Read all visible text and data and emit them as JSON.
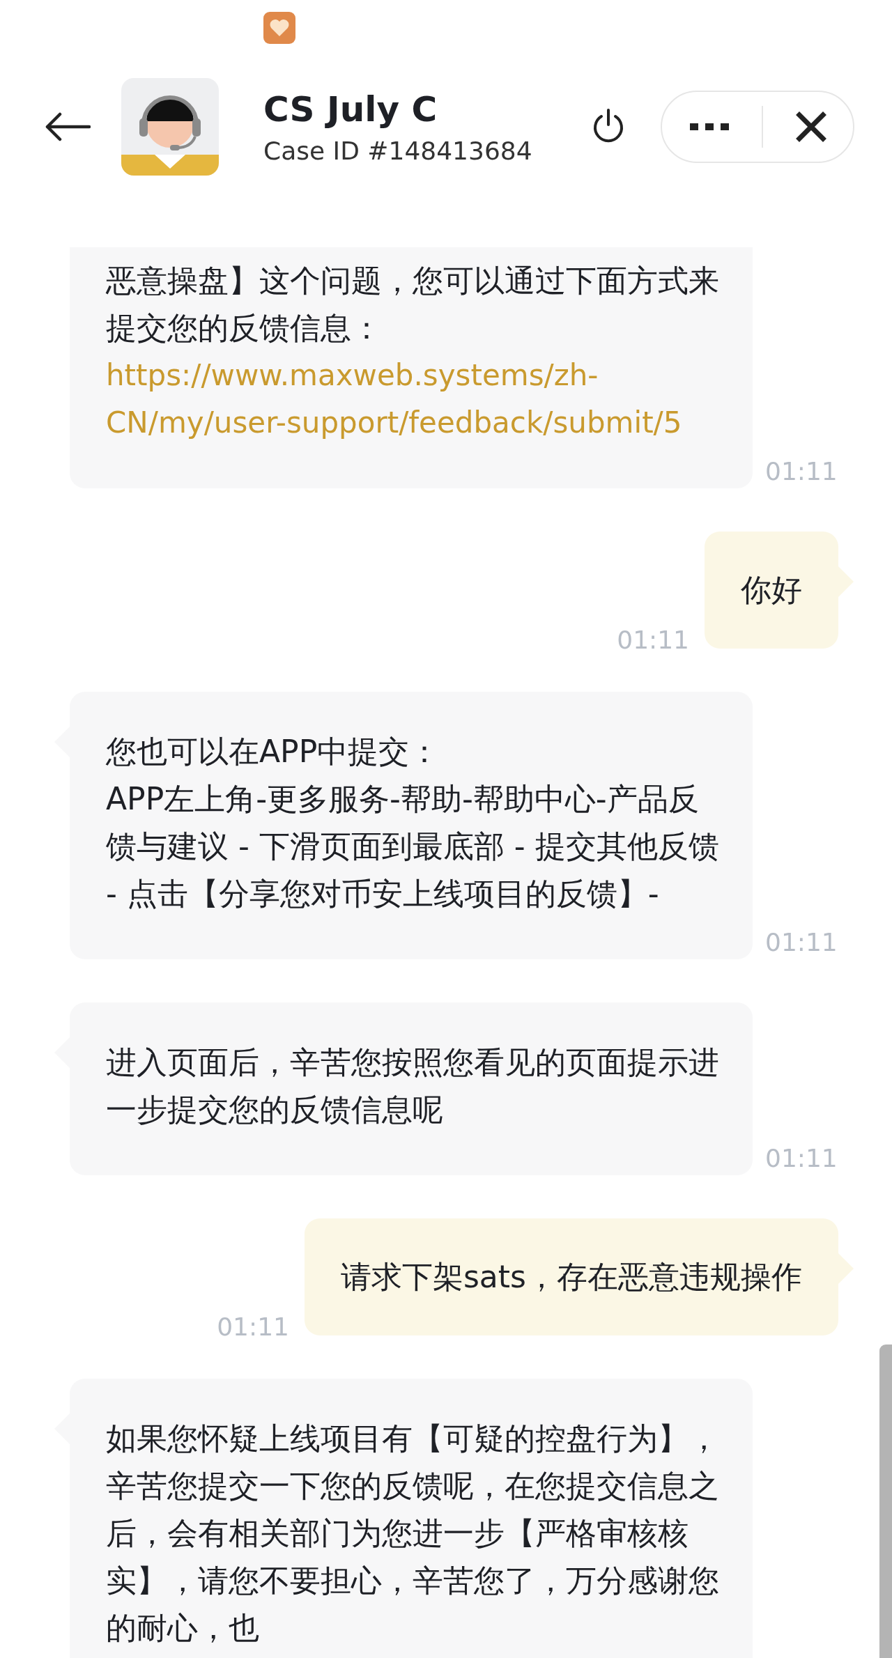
{
  "header": {
    "title": "CS July C",
    "subtitle": "Case ID #148413684"
  },
  "messages": [
    {
      "kind": "incoming",
      "text": "恶意操盘】这个问题，您可以通过下面方式来提交您的反馈信息：",
      "link": "https://www.maxweb.systems/zh-CN/my/user-support/feedback/submit/5",
      "time": "01:11"
    },
    {
      "kind": "outgoing",
      "text": "你好",
      "time": "01:11"
    },
    {
      "kind": "incoming",
      "text": "您也可以在APP中提交：\nAPP左上角-更多服务-帮助-帮助中心-产品反馈与建议 - 下滑页面到最底部 - 提交其他反馈 - 点击【分享您对币安上线项目的反馈】-",
      "time": "01:11"
    },
    {
      "kind": "incoming",
      "text": "进入页面后，辛苦您按照您看见的页面提示进一步提交您的反馈信息呢",
      "time": "01:11"
    },
    {
      "kind": "outgoing",
      "text": "请求下架sats，存在恶意违规操作",
      "time": "01:11"
    },
    {
      "kind": "incoming",
      "text": "如果您怀疑上线项目有【可疑的控盘行为】，辛苦您提交一下您的反馈呢，在您提交信息之后，会有相关部门为您进一步【严格审核核实】，请您不要担心，辛苦您了，万分感谢您的耐心，也"
    }
  ]
}
